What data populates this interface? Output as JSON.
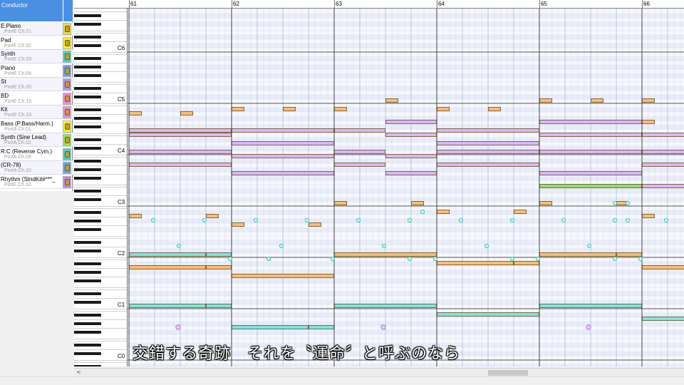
{
  "tracks": {
    "conductor": "Conductor",
    "items": [
      {
        "name": "E.Piano",
        "port": "PortE  Ch.01",
        "color": "#e0e040"
      },
      {
        "name": "Pad",
        "port": "PortE  Ch.02",
        "color": "#f6f618"
      },
      {
        "name": "Synth",
        "port": "PortE  Ch.03",
        "color": "#36d6c8"
      },
      {
        "name": "Piano",
        "port": "PortE  Ch.04",
        "color": "#5fa4f0"
      },
      {
        "name": "St",
        "port": "PortE  Ch.05",
        "color": "#b48ef0"
      },
      {
        "name": "BD",
        "port": "PortE  Ch.15",
        "color": "#f08ae8"
      },
      {
        "name": "Kit",
        "port": "PortE  Ch.16",
        "color": "#f08ae8"
      },
      {
        "name": "Bass (P.Bass/Harm.)",
        "port": "PortA  Ch.01",
        "color": "#f6f618"
      },
      {
        "name": "Synth (Sine Lead)",
        "port": "PortA  Ch.02",
        "color": "#8ae85a"
      },
      {
        "name": "R.C (Reverse Cym.)",
        "port": "PortA  Ch.09",
        "color": "#36d6c8"
      },
      {
        "name": " (CR-78)",
        "port": "PortA  Ch.10",
        "color": "#5fa4f0"
      },
      {
        "name": "Rhythm (StndKit#***_",
        "port": "PortF  Ch.10",
        "color": "#b48ef0"
      }
    ]
  },
  "ruler": {
    "measures": [
      "61",
      "62",
      "63",
      "64",
      "65",
      "66"
    ]
  },
  "keyboard": {
    "octaves": [
      "C6",
      "C5",
      "C4",
      "C3",
      "C2",
      "C1",
      "C0"
    ]
  },
  "lyric": "交錯する奇跡　それを〝運命〞と呼ぶのなら",
  "colors": {
    "orange_note": "#f9be72",
    "purple_note": "#d8b8f8",
    "green_note": "#88e070",
    "cyan_note": "#7ae6e0",
    "drum_dot": "#3ec8c0",
    "violet_dot": "#b070e0",
    "note_border": "#6a4a1a"
  },
  "scroll": {
    "left_arrow": "<"
  }
}
